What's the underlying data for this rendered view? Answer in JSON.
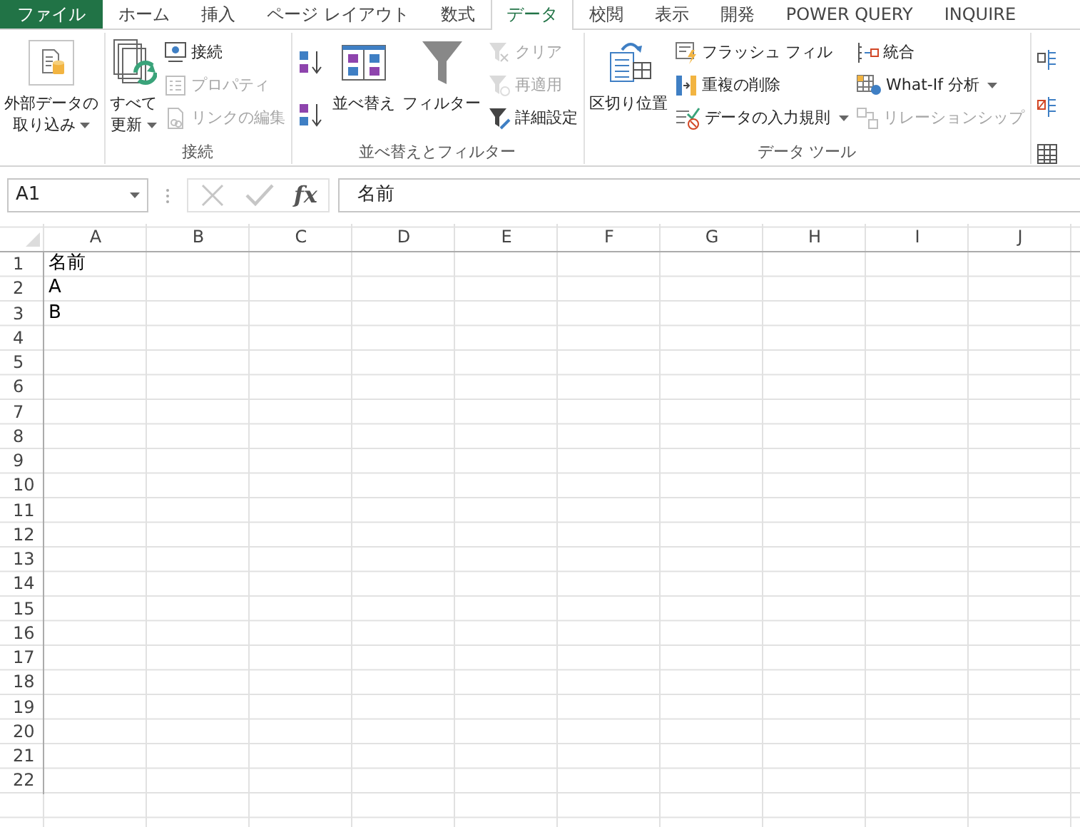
{
  "tabs": [
    {
      "label": "ファイル",
      "kind": "file",
      "selected": false
    },
    {
      "label": "ホーム",
      "kind": "tab",
      "selected": false
    },
    {
      "label": "挿入",
      "kind": "tab",
      "selected": false
    },
    {
      "label": "ページ レイアウト",
      "kind": "tab",
      "selected": false
    },
    {
      "label": "数式",
      "kind": "tab",
      "selected": false
    },
    {
      "label": "データ",
      "kind": "tab",
      "selected": true
    },
    {
      "label": "校閲",
      "kind": "tab",
      "selected": false
    },
    {
      "label": "表示",
      "kind": "tab",
      "selected": false
    },
    {
      "label": "開発",
      "kind": "tab",
      "selected": false
    },
    {
      "label": "POWER QUERY",
      "kind": "tab",
      "selected": false
    },
    {
      "label": "INQUIRE",
      "kind": "tab",
      "selected": false
    }
  ],
  "ribbon": {
    "groups": [
      {
        "columns": [
          [
            {
              "kind": "large",
              "lines": [
                "外部データの",
                "取り込み"
              ],
              "dropdown": true,
              "disabled": false
            }
          ]
        ]
      },
      {
        "label": "接続",
        "columns": [
          [
            {
              "kind": "large",
              "lines": [
                "すべて",
                "更新"
              ],
              "dropdown": true,
              "disabled": false
            }
          ],
          [
            {
              "kind": "small",
              "lines": [
                "接続"
              ],
              "disabled": false
            },
            {
              "kind": "small",
              "lines": [
                "プロパティ"
              ],
              "disabled": true
            },
            {
              "kind": "small",
              "lines": [
                "リンクの編集"
              ],
              "disabled": true
            }
          ]
        ]
      },
      {
        "label": "並べ替えとフィルター",
        "columns": [
          [
            {
              "kind": "icon",
              "disabled": false
            },
            {
              "kind": "icon",
              "disabled": false
            }
          ],
          [
            {
              "kind": "large",
              "lines": [
                "並べ替え"
              ],
              "disabled": false
            }
          ],
          [
            {
              "kind": "large",
              "lines": [
                "フィルター"
              ],
              "disabled": false
            }
          ],
          [
            {
              "kind": "small",
              "lines": [
                "クリア"
              ],
              "disabled": true
            },
            {
              "kind": "small",
              "lines": [
                "再適用"
              ],
              "disabled": true
            },
            {
              "kind": "small",
              "lines": [
                "詳細設定"
              ],
              "disabled": false
            }
          ]
        ]
      },
      {
        "label": "データ ツール",
        "columns": [
          [
            {
              "kind": "large",
              "lines": [
                "区切り位置"
              ],
              "disabled": false
            }
          ],
          [
            {
              "kind": "small",
              "lines": [
                "フラッシュ フィル"
              ],
              "disabled": false
            },
            {
              "kind": "small",
              "lines": [
                "重複の削除"
              ],
              "disabled": false
            },
            {
              "kind": "small",
              "lines": [
                "データの入力規則"
              ],
              "dropdown": true,
              "disabled": false
            }
          ],
          [
            {
              "kind": "small",
              "lines": [
                "統合"
              ],
              "disabled": false
            },
            {
              "kind": "small",
              "lines": [
                "What-If 分析"
              ],
              "dropdown": true,
              "disabled": false
            },
            {
              "kind": "small",
              "lines": [
                "リレーションシップ"
              ],
              "disabled": true
            }
          ]
        ]
      },
      {
        "columns": [
          [
            {
              "kind": "icon",
              "disabled": false
            },
            {
              "kind": "icon",
              "disabled": false
            },
            {
              "kind": "icon",
              "disabled": false
            }
          ]
        ]
      }
    ]
  },
  "formula_bar": {
    "name_box": "A1",
    "function_label": "fx",
    "formula": "名前"
  },
  "sheet": {
    "columns": [
      "A",
      "B",
      "C",
      "D",
      "E",
      "F",
      "G",
      "H",
      "I",
      "J"
    ],
    "rows": [
      {
        "label": "1",
        "cells": [
          "名前"
        ]
      },
      {
        "label": "2",
        "cells": [
          "A"
        ]
      },
      {
        "label": "3",
        "cells": [
          "B"
        ]
      },
      {
        "label": "4"
      },
      {
        "label": "5"
      },
      {
        "label": "6"
      },
      {
        "label": "7"
      },
      {
        "label": "8"
      },
      {
        "label": "9"
      },
      {
        "label": "10"
      },
      {
        "label": "11"
      },
      {
        "label": "12"
      },
      {
        "label": "13"
      },
      {
        "label": "14"
      },
      {
        "label": "15"
      },
      {
        "label": "16"
      },
      {
        "label": "17"
      },
      {
        "label": "18"
      },
      {
        "label": "19"
      },
      {
        "label": "20"
      },
      {
        "label": "21"
      },
      {
        "label": "22"
      }
    ]
  }
}
